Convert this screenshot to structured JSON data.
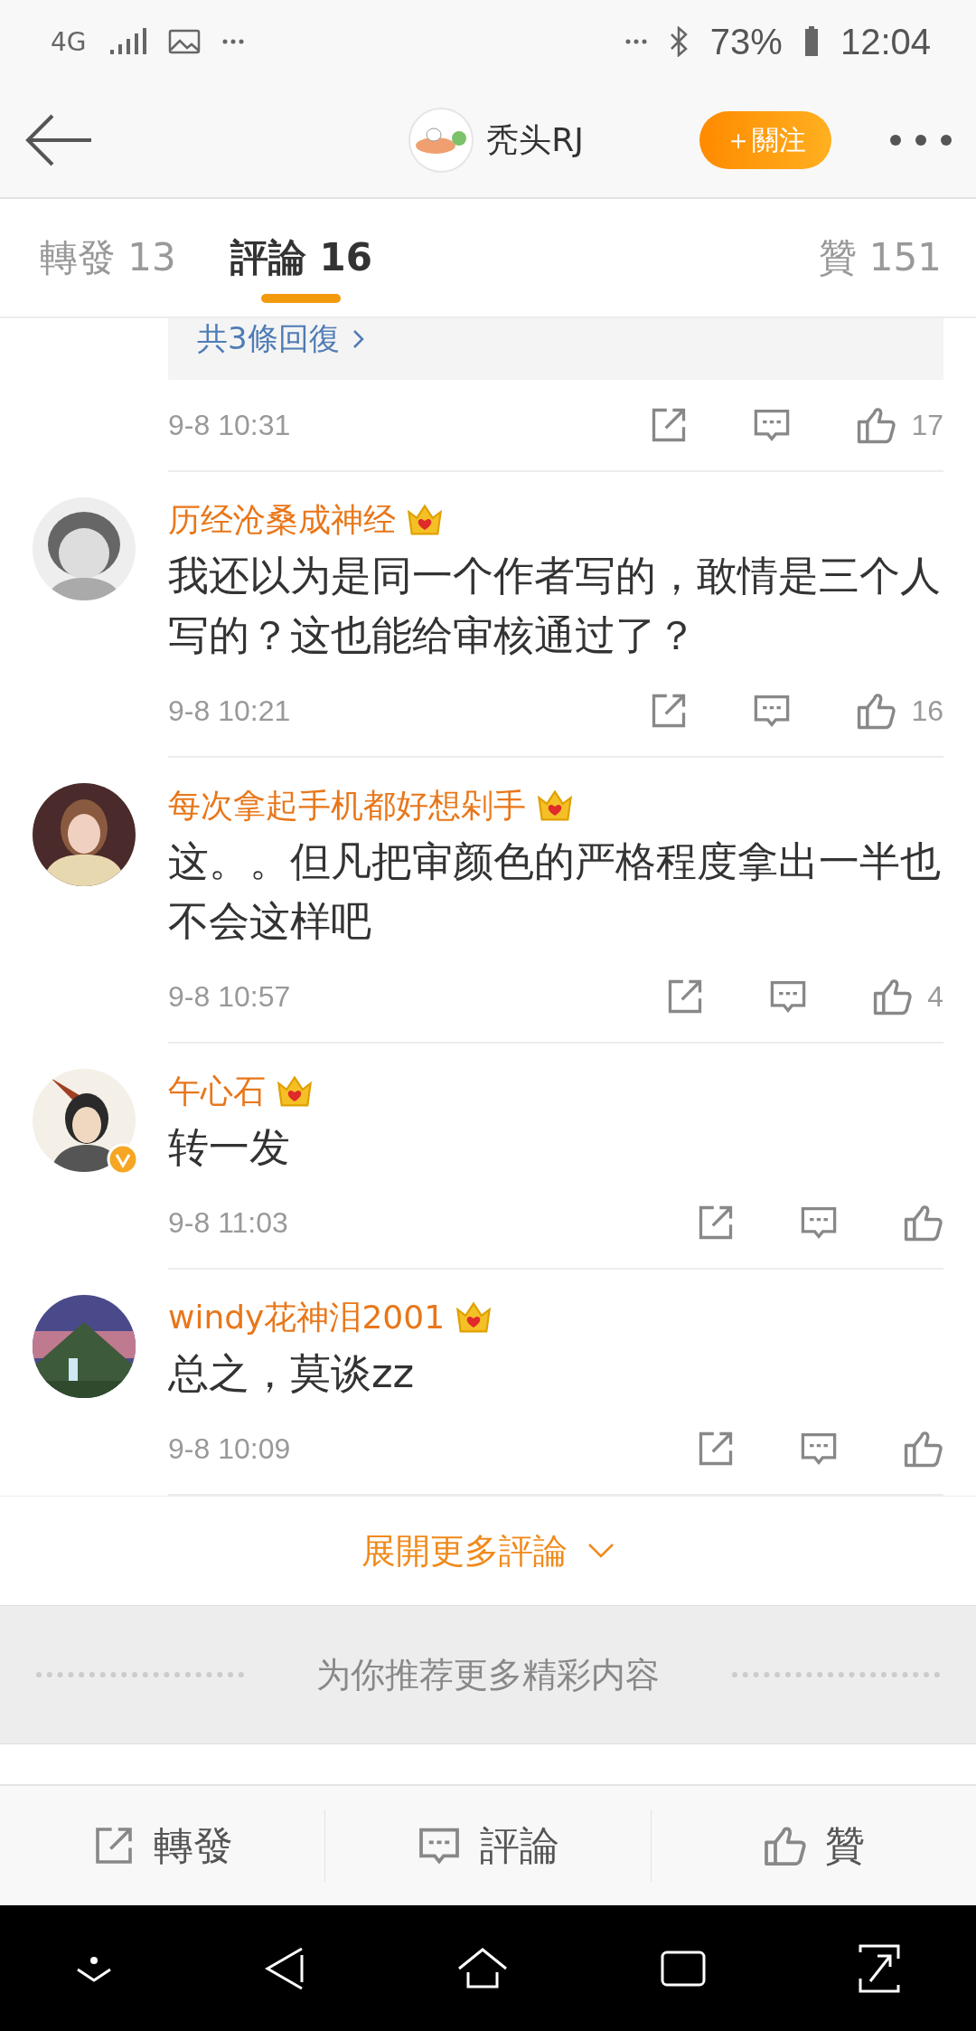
{
  "status_bar": {
    "network": "4G",
    "battery": "73%",
    "time": "12:04"
  },
  "header": {
    "title": "秃头RJ",
    "follow_button": "＋關注"
  },
  "tabs": [
    {
      "label": "轉發 13",
      "selected": false
    },
    {
      "label": "評論 16",
      "selected": true
    },
    {
      "label": "贊 151",
      "selected": false
    }
  ],
  "replies_link": "共3條回復",
  "first_comment": {
    "time": "9-8 10:31",
    "likes": "17"
  },
  "comments": [
    {
      "name": "历经沧桑成神经",
      "text": "我还以为是同一个作者写的，敢情是三个人写的？这也能给审核通过了？",
      "time": "9-8 10:21",
      "likes": "16",
      "verified": false
    },
    {
      "name": "每次拿起手机都好想剁手",
      "text": "这。。但凡把审颜色的严格程度拿出一半也不会这样吧",
      "time": "9-8 10:57",
      "likes": "4",
      "verified": false
    },
    {
      "name": "午心石",
      "text": "转一发",
      "time": "9-8 11:03",
      "verified": true
    },
    {
      "name": "windy花神泪2001",
      "text": "总之，莫谈zz",
      "time": "9-8 10:09",
      "verified": false
    }
  ],
  "expand_link": "展開更多評論",
  "recommend_banner": "为你推荐更多精彩内容",
  "bottom_actions": [
    {
      "kind": "repost",
      "label": "轉發"
    },
    {
      "kind": "comment",
      "label": "評論"
    },
    {
      "kind": "like",
      "label": "贊"
    }
  ]
}
